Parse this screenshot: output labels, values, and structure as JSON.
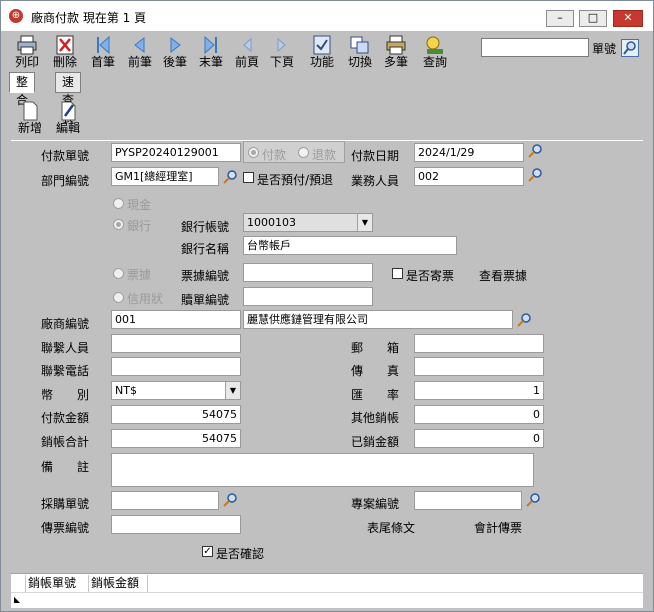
{
  "window": {
    "title": "廠商付款  現在第 1 頁",
    "min_label": "–",
    "max_label": "□",
    "close_label": "✕"
  },
  "toolbar": {
    "print": "列印",
    "delete": "刪除",
    "first": "首筆",
    "prev": "前筆",
    "next": "後筆",
    "last": "末筆",
    "prev_page": "前頁",
    "next_page": "下頁",
    "function": "功能",
    "switch": "切換",
    "multi": "多筆",
    "query": "查詢",
    "search_label": "單號",
    "search_value": ""
  },
  "tabs": {
    "integrate": "整合",
    "quick_table": "速查表"
  },
  "subtoolbar": {
    "new": "新增",
    "edit": "編輯"
  },
  "form": {
    "payment_no_label": "付款單號",
    "payment_no": "PYSP20240129001",
    "radio_pay": "付款",
    "radio_refund": "退款",
    "payment_date_label": "付款日期",
    "payment_date": "2024/1/29",
    "dept_label": "部門編號",
    "dept": "GM1[總經理室]",
    "prepay_label": "是否預付/預退",
    "sales_label": "業務人員",
    "sales": "002",
    "cash_label": "現金",
    "bank_label": "銀行",
    "bank_account_label": "銀行帳號",
    "bank_account": "1000103",
    "bank_name_label": "銀行名稱",
    "bank_name": "台幣帳戶",
    "bill_label": "票據",
    "bill_no_label": "票據編號",
    "bill_no": "",
    "send_bill_label": "是否寄票",
    "view_bill_label": "查看票據",
    "credit_label": "信用狀",
    "redeem_no_label": "贖單編號",
    "redeem_no": "",
    "vendor_no_label": "廠商編號",
    "vendor_no": "001",
    "vendor_name": "麗慧供應鏈管理有限公司",
    "contact_label": "聯繫人員",
    "contact": "",
    "mailbox_label": "郵　　箱",
    "mailbox": "",
    "phone_label": "聯繫電話",
    "phone": "",
    "fax_label": "傳　　真",
    "fax": "",
    "currency_label": "幣　　別",
    "currency": "NT$",
    "rate_label": "匯　　率",
    "rate": "1",
    "pay_amount_label": "付款金額",
    "pay_amount": "54075",
    "other_offset_label": "其他銷帳",
    "other_offset": "0",
    "offset_total_label": "銷帳合計",
    "offset_total": "54075",
    "offset_amount_label": "已銷金額",
    "offset_amount": "0",
    "remark_label": "備　　註",
    "remark": "",
    "po_no_label": "採購單號",
    "po_no": "",
    "project_no_label": "專案編號",
    "project_no": "",
    "voucher_no_label": "傳票編號",
    "voucher_no": "",
    "footer_text_label": "表尾條文",
    "accounting_voucher_label": "會計傳票",
    "confirm_label": "是否確認"
  },
  "grid": {
    "col1": "銷帳單號",
    "col2": "銷帳金額"
  },
  "colors": {
    "titlebar": "#ffffff",
    "panel": "#c0c0c0",
    "close": "#c8382c"
  }
}
